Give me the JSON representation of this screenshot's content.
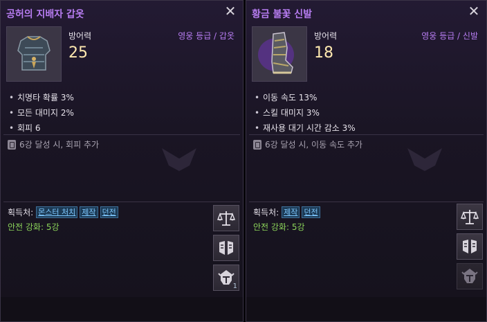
{
  "left": {
    "title": "공허의 지배자 갑옷",
    "close": "✕",
    "stat_label": "방어력",
    "stat_value": "25",
    "grade": "영웅 등급 / 갑옷",
    "options": [
      "치명타 확률 3%",
      "모든 대미지 2%",
      "회피 6"
    ],
    "bonus": "6강 달성 시, 회피 추가",
    "acquire_label": "획득처:",
    "acquire_tags": [
      "몬스터 처치",
      "제작",
      "던전"
    ],
    "safe_enhance": "안전 강화: 5강",
    "side_count": "1"
  },
  "right": {
    "title": "황금 불꽃 신발",
    "close": "✕",
    "stat_label": "방어력",
    "stat_value": "18",
    "grade": "영웅 등급 / 신발",
    "options": [
      "이동 속도 13%",
      "스킬 대미지 3%",
      "재사용 대기 시간 감소 3%"
    ],
    "bonus": "6강 달성 시, 이동 속도 추가",
    "acquire_label": "획득처:",
    "acquire_tags": [
      "제작",
      "던전"
    ],
    "safe_enhance": "안전 강화: 5강"
  },
  "icons": {
    "armor": "armor-icon",
    "boots": "boots-icon",
    "scale": "scale-icon",
    "compare": "compare-icon",
    "helmet": "helmet-icon",
    "bonus": "scroll-icon",
    "close": "close-icon"
  },
  "colors": {
    "title_purple": "#b67cf0",
    "value_gold": "#ffe9b0",
    "safe_green": "#8cd45a",
    "link_blue": "#7ec8ff"
  }
}
